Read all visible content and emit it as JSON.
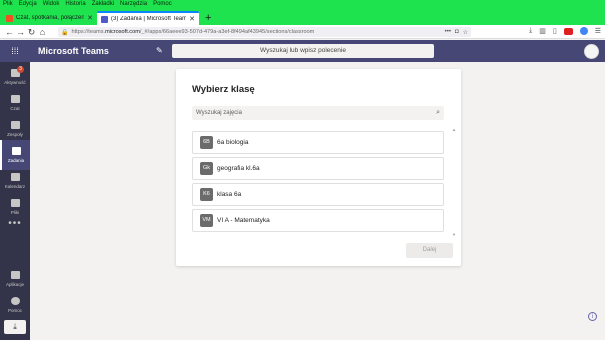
{
  "browser": {
    "menu": [
      "Plik",
      "Edycja",
      "Widok",
      "Historia",
      "Zakładki",
      "Narzędzia",
      "Pomoc"
    ],
    "tabs": [
      {
        "title": "Czat, spotkania, połączenia, w...",
        "favicon_color": "#f25022"
      },
      {
        "title": "(3) Zadania | Microsoft Teams",
        "favicon_color": "#5059c9"
      }
    ],
    "url_prefix": "https://teams.",
    "url_domain": "microsoft.com",
    "url_rest": "/_#/apps/66aeee93-507d-479a-a3ef-8f494af43945/sections/classroom"
  },
  "teams": {
    "app_name": "Microsoft Teams",
    "search_placeholder": "Wyszukaj lub wpisz polecenie",
    "rail": [
      {
        "label": "Aktywność",
        "badge": "3"
      },
      {
        "label": "Czat"
      },
      {
        "label": "Zespoły"
      },
      {
        "label": "Zadania"
      },
      {
        "label": "Kalendarz"
      },
      {
        "label": "Pliki"
      }
    ],
    "rail_more": "•••",
    "rail_bottom": [
      {
        "label": "Aplikacje"
      },
      {
        "label": "Pomoc"
      }
    ]
  },
  "dialog": {
    "title": "Wybierz klasę",
    "search_placeholder": "Wyszukaj zajęcia",
    "classes": [
      {
        "abbr": "6B",
        "name": "6a biologia"
      },
      {
        "abbr": "Gk",
        "name": "geografia kl.6a"
      },
      {
        "abbr": "K6",
        "name": "klasa 6a"
      },
      {
        "abbr": "VM",
        "name": "VI A - Matematyka"
      }
    ],
    "next_label": "Dalej"
  },
  "colors": {
    "browser_chrome": "#1fe24f",
    "teams_header": "#464775",
    "teams_rail": "#33344a",
    "accent": "#6264a7"
  }
}
